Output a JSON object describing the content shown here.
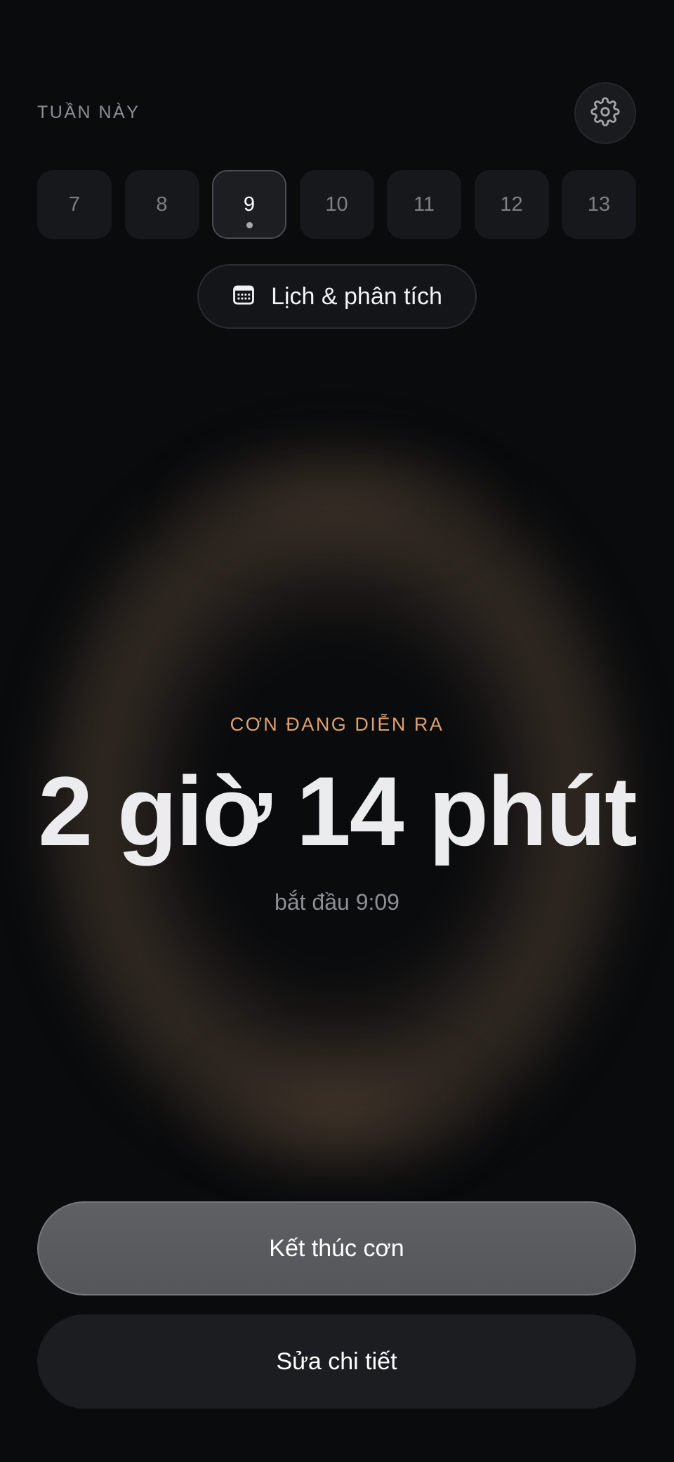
{
  "header": {
    "week_label": "TUẦN NÀY",
    "settings_icon": "gear-icon"
  },
  "days": [
    {
      "label": "7",
      "selected": false
    },
    {
      "label": "8",
      "selected": false
    },
    {
      "label": "9",
      "selected": true
    },
    {
      "label": "10",
      "selected": false
    },
    {
      "label": "11",
      "selected": false
    },
    {
      "label": "12",
      "selected": false
    },
    {
      "label": "13",
      "selected": false
    }
  ],
  "calendar_button": {
    "icon": "calendar-icon",
    "label": "Lịch & phân tích"
  },
  "contraction": {
    "status": "CƠN ĐANG DIỄN RA",
    "elapsed": "2 giờ 14 phút",
    "started": "bắt đầu 9:09"
  },
  "actions": {
    "end_label": "Kết thúc cơn",
    "edit_label": "Sửa chi tiết"
  },
  "colors": {
    "background": "#0a0b0d",
    "accent": "#e0a06d",
    "primary_button": "#58595d",
    "secondary_button": "#1c1d20"
  }
}
